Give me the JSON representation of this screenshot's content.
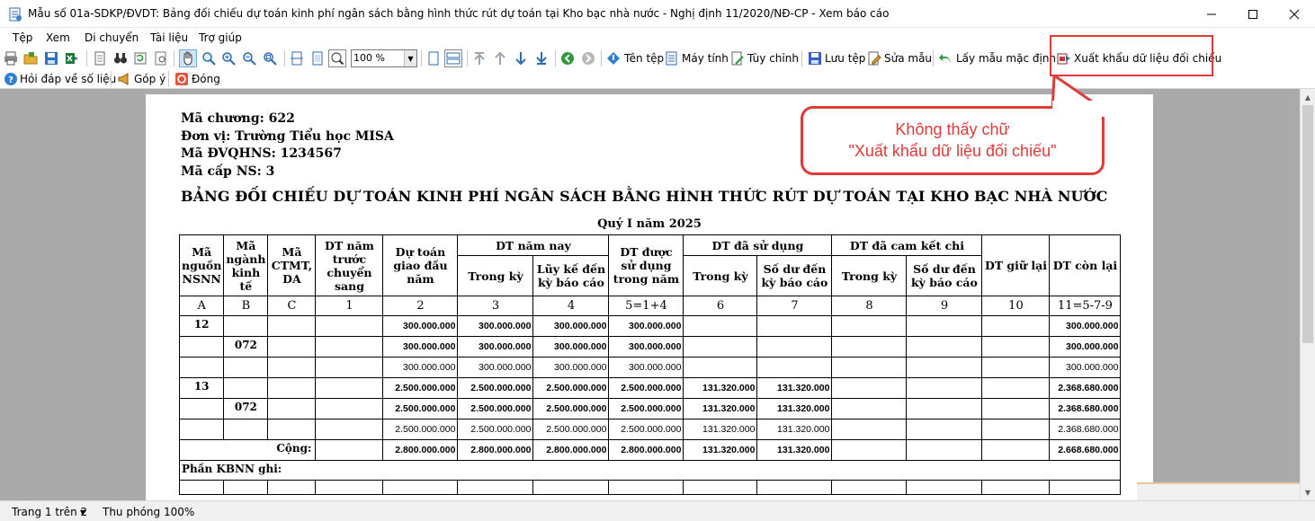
{
  "window": {
    "title": "Mẫu số 01a-SDKP/ĐVDT: Bảng đối chiếu dự toán kinh phí ngân sách bằng hình thức rút dự toán tại Kho bạc nhà nước - Nghị định 11/2020/NĐ-CP - Xem báo cáo"
  },
  "menu": [
    "Tệp",
    "Xem",
    "Di chuyển",
    "Tài liệu",
    "Trợ giúp"
  ],
  "toolbar": {
    "zoom_value": "100 %",
    "file_name_label": "Tên tệp",
    "computer_label": "Máy tính",
    "customize_label": "Tùy chỉnh",
    "save_file_label": "Lưu tệp",
    "edit_template_label": "Sửa mẫu",
    "default_template_label": "Lấy mẫu mặc định",
    "export_label": "Xuất khẩu dữ liệu đối chiếu",
    "ask_data_label": "Hỏi đáp về số liệu",
    "feedback_label": "Góp ý",
    "close_label": "Đóng"
  },
  "callout": {
    "line1": "Không thấy chữ",
    "line2": "\"Xuất khẩu dữ liệu đối chiếu\""
  },
  "report": {
    "chapter": "Mã chương: 622",
    "unit": "Đơn vị: Trường Tiểu học MISA",
    "dvqhns": "Mã ĐVQHNS: 1234567",
    "budget_level": "Mã cấp NS: 3",
    "title": "BẢNG ĐỐI CHIẾU DỰ TOÁN KINH PHÍ NGÂN SÁCH BẰNG HÌNH THỨC RÚT DỰ TOÁN TẠI KHO BẠC NHÀ NƯỚC",
    "period": "Quý I năm 2025",
    "headers": {
      "ma_nguon": "Mã nguồn NSNN",
      "ma_nganh": "Mã ngành kinh tế",
      "ma_ctmt": "Mã CTMT, DA",
      "dt_nam_truoc": "DT năm trước chuyển sang",
      "du_toan_giao": "Dự toán giao đầu năm",
      "dt_nam_nay": "DT năm nay",
      "trong_ky_1": "Trong kỳ",
      "luy_ke": "Lũy kế đến kỳ báo cáo",
      "dt_duoc_su_dung": "DT được sử dụng trong năm",
      "dt_da_su_dung": "DT đã sử dụng",
      "trong_ky_2": "Trong kỳ",
      "so_du_1": "Số dư đến kỳ báo cáo",
      "dt_cam_ket": "DT đã cam kết chi",
      "trong_ky_3": "Trong kỳ",
      "so_du_2": "Số dư đến kỳ báo cáo",
      "dt_giu_lai": "DT giữ lại",
      "dt_con_lai": "DT còn lại"
    },
    "index_row": [
      "A",
      "B",
      "C",
      "1",
      "2",
      "3",
      "4",
      "5=1+4",
      "6",
      "7",
      "8",
      "9",
      "10",
      "11=5-7-9"
    ],
    "rows": [
      [
        "12",
        "",
        "",
        "",
        "300.000.000",
        "300.000.000",
        "300.000.000",
        "300.000.000",
        "",
        "",
        "",
        "",
        "",
        "300.000.000"
      ],
      [
        "",
        "072",
        "",
        "",
        "300.000.000",
        "300.000.000",
        "300.000.000",
        "300.000.000",
        "",
        "",
        "",
        "",
        "",
        "300.000.000"
      ],
      [
        "",
        "",
        "",
        "",
        "300.000.000",
        "300.000.000",
        "300.000.000",
        "300.000.000",
        "",
        "",
        "",
        "",
        "",
        "300.000.000"
      ],
      [
        "13",
        "",
        "",
        "",
        "2.500.000.000",
        "2.500.000.000",
        "2.500.000.000",
        "2.500.000.000",
        "131.320.000",
        "131.320.000",
        "",
        "",
        "",
        "2.368.680.000"
      ],
      [
        "",
        "072",
        "",
        "",
        "2.500.000.000",
        "2.500.000.000",
        "2.500.000.000",
        "2.500.000.000",
        "131.320.000",
        "131.320.000",
        "",
        "",
        "",
        "2.368.680.000"
      ],
      [
        "",
        "",
        "",
        "",
        "2.500.000.000",
        "2.500.000.000",
        "2.500.000.000",
        "2.500.000.000",
        "131.320.000",
        "131.320.000",
        "",
        "",
        "",
        "2.368.680.000"
      ]
    ],
    "total_label": "Cộng:",
    "total_row": [
      "2.800.000.000",
      "2.800.000.000",
      "2.800.000.000",
      "2.800.000.000",
      "131.320.000",
      "131.320.000",
      "",
      "",
      "",
      "2.668.680.000"
    ],
    "kbnn_note": "Phần KBNN ghi:"
  },
  "status": {
    "page_info": "Trang 1 trên 2",
    "zoom_info": "Thu phóng 100%"
  }
}
